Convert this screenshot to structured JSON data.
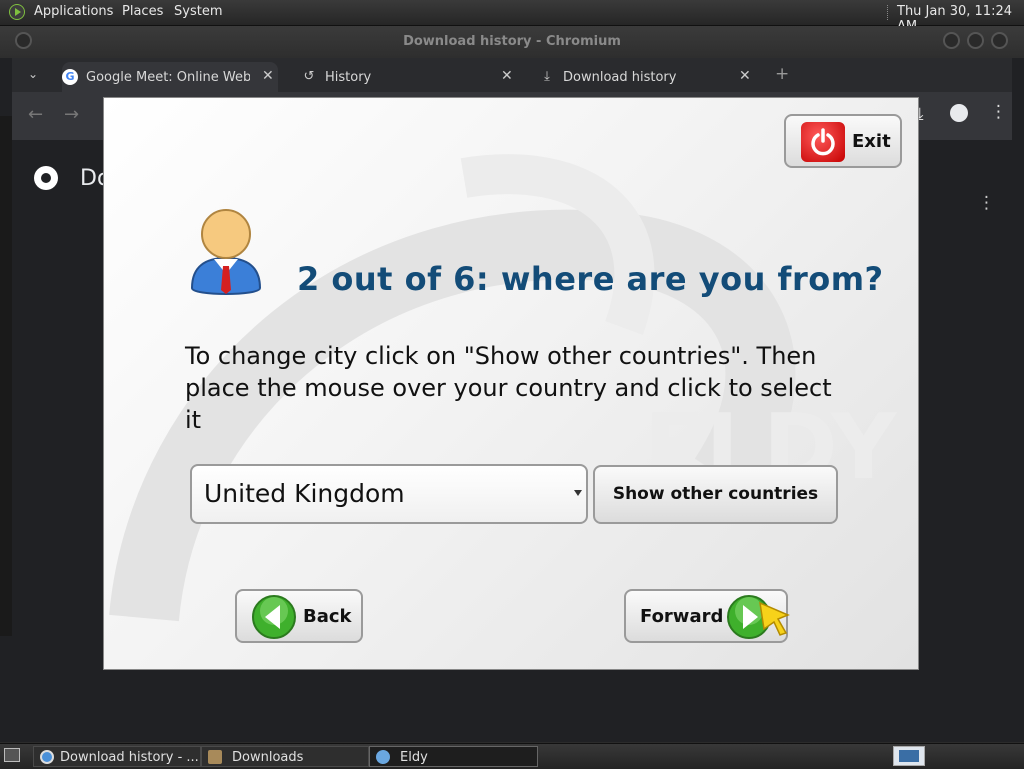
{
  "top_panel": {
    "menu": [
      "Applications",
      "Places",
      "System"
    ],
    "clock": "Thu Jan 30, 11:24 AM"
  },
  "window": {
    "title": "Download history - Chromium"
  },
  "tabs": [
    {
      "label": "Google Meet: Online Web an",
      "icon": "google-icon"
    },
    {
      "label": "History",
      "icon": "history-icon"
    },
    {
      "label": "Download history",
      "icon": "download-icon"
    }
  ],
  "downloads_page": {
    "heading": "Do"
  },
  "dialog": {
    "exit_label": "Exit",
    "step_title": "2 out of 6: where are you from?",
    "instructions": "To change city click on \"Show other countries\". Then place the mouse over your country and click to select it",
    "country_value": "United Kingdom",
    "show_other_label": "Show other countries",
    "back_label": "Back",
    "forward_label": "Forward"
  },
  "taskbar": [
    {
      "label": "Download history - ...",
      "icon": "chromium-icon"
    },
    {
      "label": "Downloads",
      "icon": "folder-icon"
    },
    {
      "label": "Eldy",
      "icon": "eldy-icon"
    }
  ],
  "colors": {
    "title_blue": "#134c78",
    "exit_red": "#d40000",
    "nav_green": "#3fb02c"
  }
}
